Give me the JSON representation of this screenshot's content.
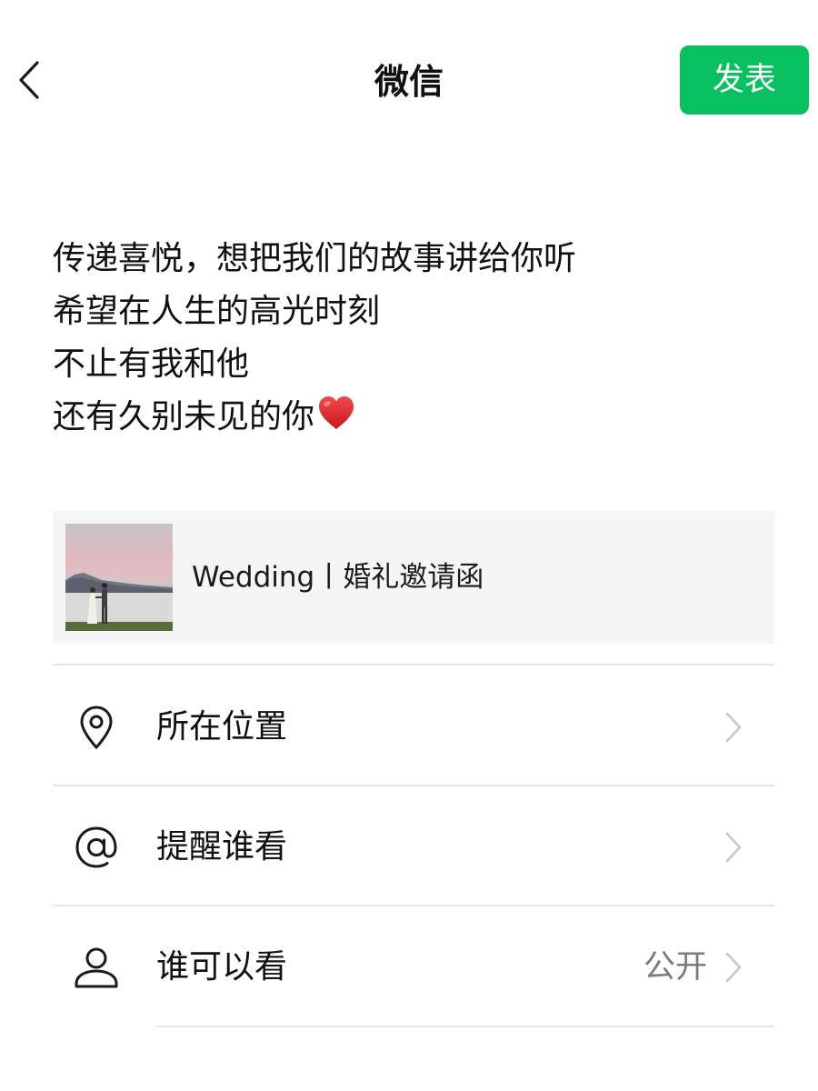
{
  "header": {
    "back_icon": "chevron-left-icon",
    "title": "微信",
    "publish_label": "发表",
    "publish_color": "#07c160"
  },
  "post": {
    "lines": [
      "传递喜悦，想把我们的故事讲给你听",
      "希望在人生的高光时刻",
      "不止有我和他",
      "还有久别未见的你"
    ],
    "trailing_emoji": "red-heart-emoji"
  },
  "link_card": {
    "title": "Wedding丨婚礼邀请函",
    "thumbnail": "wedding-couple-lakeside-photo"
  },
  "options": [
    {
      "label": "所在位置",
      "icon": "location-pin-icon",
      "value": ""
    },
    {
      "label": "提醒谁看",
      "icon": "at-sign-icon",
      "value": ""
    },
    {
      "label": "谁可以看",
      "icon": "person-icon",
      "value": "公开"
    }
  ]
}
